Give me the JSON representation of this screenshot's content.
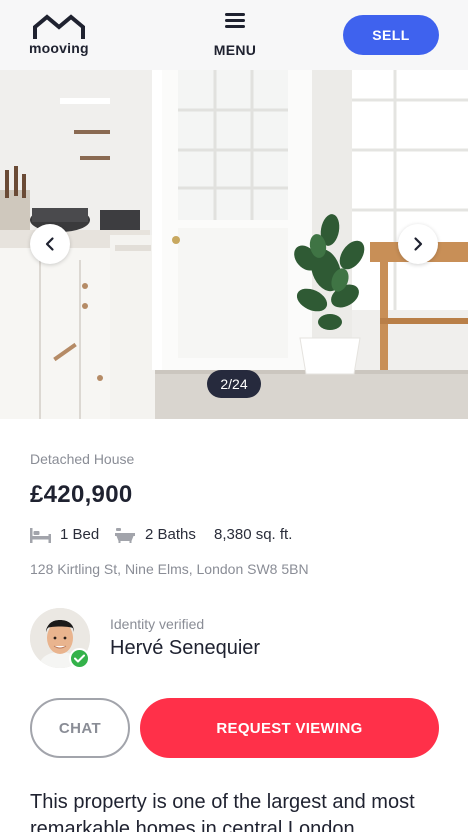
{
  "header": {
    "logo_text": "mooving",
    "menu_label": "MENU",
    "sell_label": "SELL",
    "icons": [
      "house-outline-icon",
      "hamburger-menu-icon"
    ]
  },
  "gallery": {
    "counter": "2/24",
    "icons": [
      "chevron-left-icon",
      "chevron-right-icon"
    ]
  },
  "listing": {
    "type": "Detached House",
    "price": "£420,900",
    "beds": "1 Bed",
    "baths": "2 Baths",
    "area": "8,380 sq. ft.",
    "address": "128 Kirtling St, Nine Elms, London SW8 5BN",
    "icons": [
      "bed-icon",
      "bath-icon"
    ]
  },
  "seller": {
    "verified_label": "Identity verified",
    "name": "Hervé Senequier",
    "icons": [
      "verified-check-icon"
    ]
  },
  "actions": {
    "chat_label": "CHAT",
    "request_label": "REQUEST VIEWING"
  },
  "description": "This property is one of the largest and most remarkable homes in central London",
  "colors": {
    "accent_blue": "#3f62ee",
    "accent_red": "#ff3049",
    "counter_bg": "#262a3d",
    "verified_green": "#34b24a"
  }
}
